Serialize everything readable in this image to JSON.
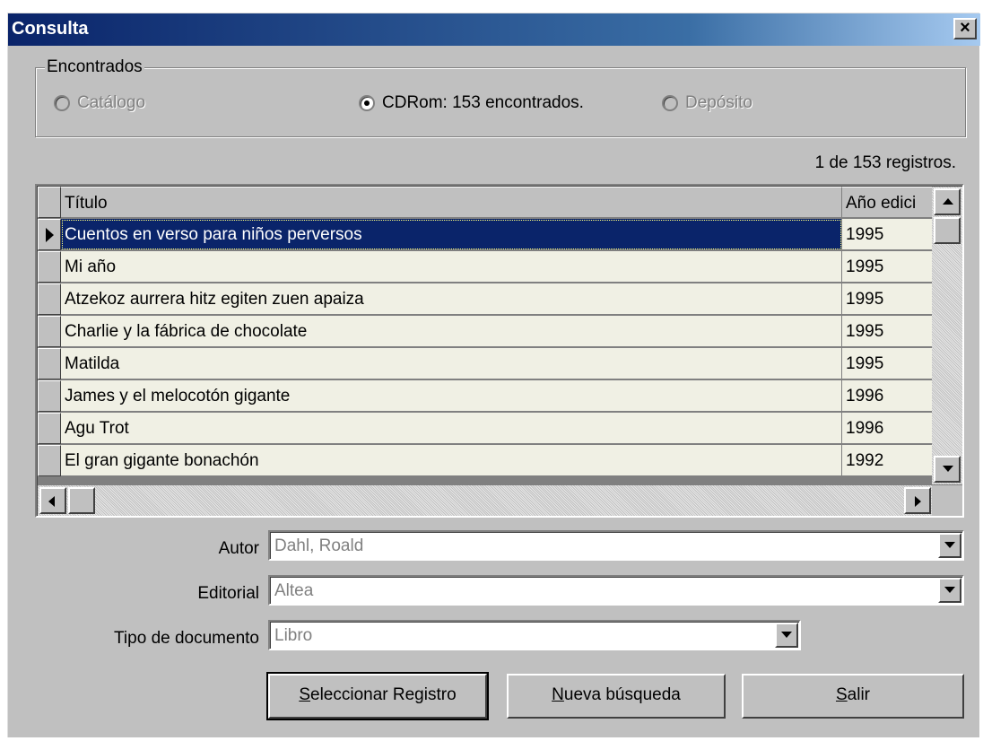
{
  "window": {
    "title": "Consulta",
    "close_label": "×"
  },
  "found_group": {
    "legend": "Encontrados",
    "options": [
      {
        "label": "Catálogo",
        "checked": false,
        "enabled": false
      },
      {
        "label": "CDRom: 153 encontrados.",
        "checked": true,
        "enabled": true
      },
      {
        "label": "Depósito",
        "checked": false,
        "enabled": false
      }
    ]
  },
  "records_status": "1 de 153 registros.",
  "grid": {
    "columns": [
      "Título",
      "Año edici"
    ],
    "rows": [
      {
        "title": "Cuentos en verso para niños perversos",
        "year": "1995",
        "selected": true
      },
      {
        "title": "Mi año",
        "year": "1995"
      },
      {
        "title": "Atzekoz aurrera hitz egiten zuen apaiza",
        "year": "1995"
      },
      {
        "title": "Charlie y la fábrica de chocolate",
        "year": "1995"
      },
      {
        "title": "Matilda",
        "year": "1995"
      },
      {
        "title": "James y el melocotón gigante",
        "year": "1996"
      },
      {
        "title": "Agu Trot",
        "year": "1996"
      },
      {
        "title": "El gran gigante bonachón",
        "year": "1992"
      }
    ]
  },
  "fields": {
    "autor": {
      "label": "Autor",
      "value": "Dahl, Roald"
    },
    "editorial": {
      "label": "Editorial",
      "value": "Altea"
    },
    "tipo": {
      "label": "Tipo de documento",
      "value": "Libro"
    }
  },
  "buttons": {
    "select": {
      "mnemonic": "S",
      "rest": "eleccionar Registro"
    },
    "new_search": {
      "mnemonic": "N",
      "rest": "ueva búsqueda"
    },
    "exit": {
      "mnemonic": "S",
      "rest": "alir"
    }
  },
  "icons": [
    "close-icon",
    "row-pointer-icon",
    "scroll-up-icon",
    "scroll-down-icon",
    "scroll-left-icon",
    "scroll-right-icon",
    "dropdown-arrow-icon"
  ],
  "colors": {
    "selection": "#0a246a",
    "title_bar": "#0a246a",
    "grid_row_bg": "#f0f0e4",
    "face": "#c0c0c0"
  }
}
